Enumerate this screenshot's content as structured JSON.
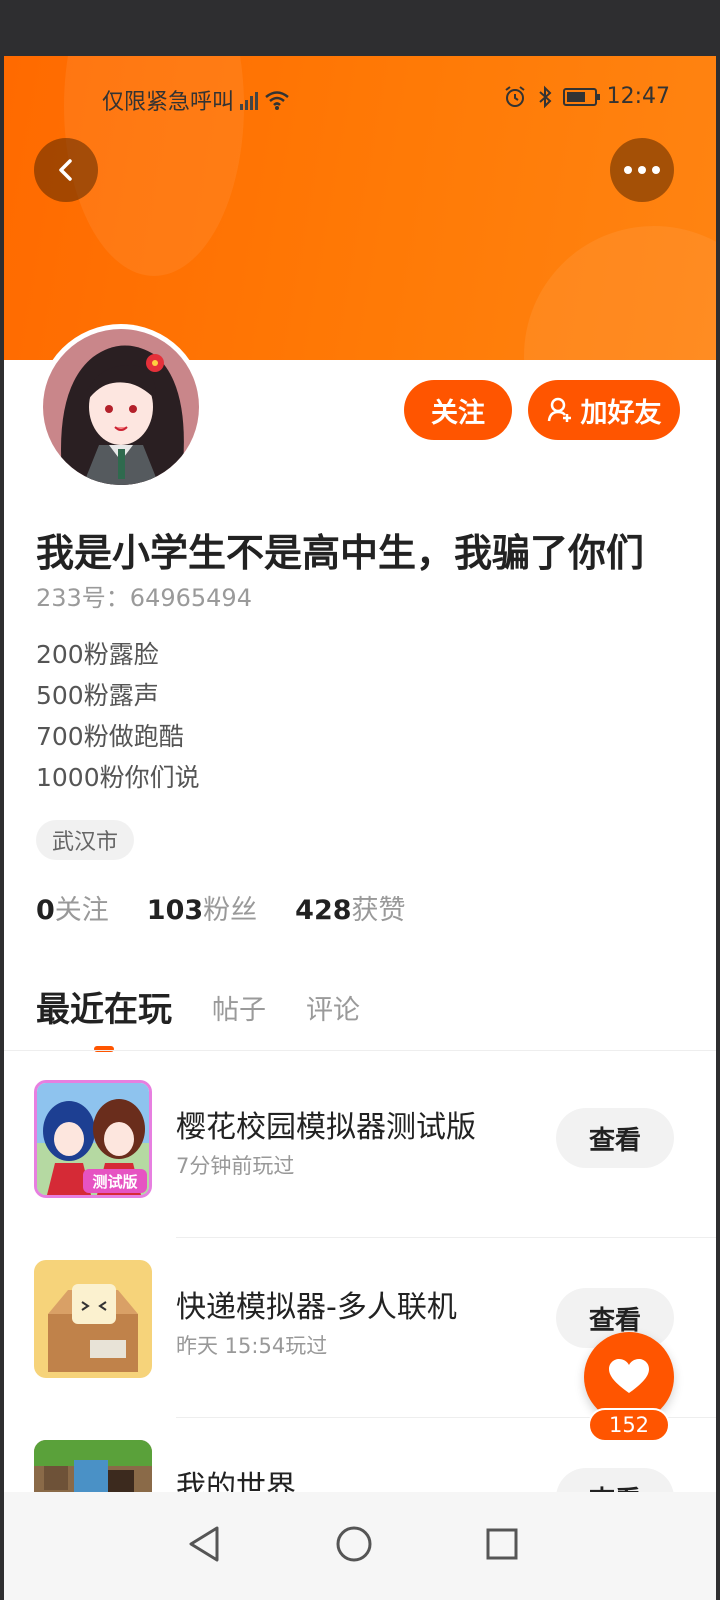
{
  "statusbar": {
    "carrier": "仅限紧急呼叫",
    "time": "12:47",
    "battery_level": 0.7,
    "icons": [
      "signal-icon",
      "wifi-icon",
      "alarm-icon",
      "bluetooth-icon",
      "battery-icon"
    ]
  },
  "header": {
    "back_icon": "chevron-left-icon",
    "more_icon": "more-dots-icon",
    "gradient_colors": [
      "#ff6a00",
      "#ff8412"
    ]
  },
  "profile": {
    "follow_label": "关注",
    "add_friend_label": "加好友",
    "nickname": "我是小学生不是高中生，我骗了你们",
    "uid": "233号：64965494",
    "bio_lines": [
      "200粉露脸",
      "500粉露声",
      "700粉做跑酷",
      "1000粉你们说"
    ],
    "location": "武汉市",
    "stats": [
      {
        "num": "0",
        "label": "关注"
      },
      {
        "num": "103",
        "label": "粉丝"
      },
      {
        "num": "428",
        "label": "获赞"
      }
    ]
  },
  "tabs": [
    {
      "label": "最近在玩",
      "active": true
    },
    {
      "label": "帖子",
      "active": false
    },
    {
      "label": "评论",
      "active": false
    }
  ],
  "games": [
    {
      "name": "樱花校园模拟器测试版",
      "time": "7分钟前玩过",
      "button": "查看"
    },
    {
      "name": "快递模拟器-多人联机",
      "time": "昨天 15:54玩过",
      "button": "查看"
    },
    {
      "name": "我的世界",
      "time": "",
      "button": "查看"
    }
  ],
  "game_icon_badge": "测试版",
  "like": {
    "count": "152",
    "icon": "heart-icon"
  },
  "navbar": {
    "icons": [
      "back-triangle-icon",
      "home-circle-icon",
      "recents-square-icon"
    ]
  },
  "accent_color": "#ff5500"
}
